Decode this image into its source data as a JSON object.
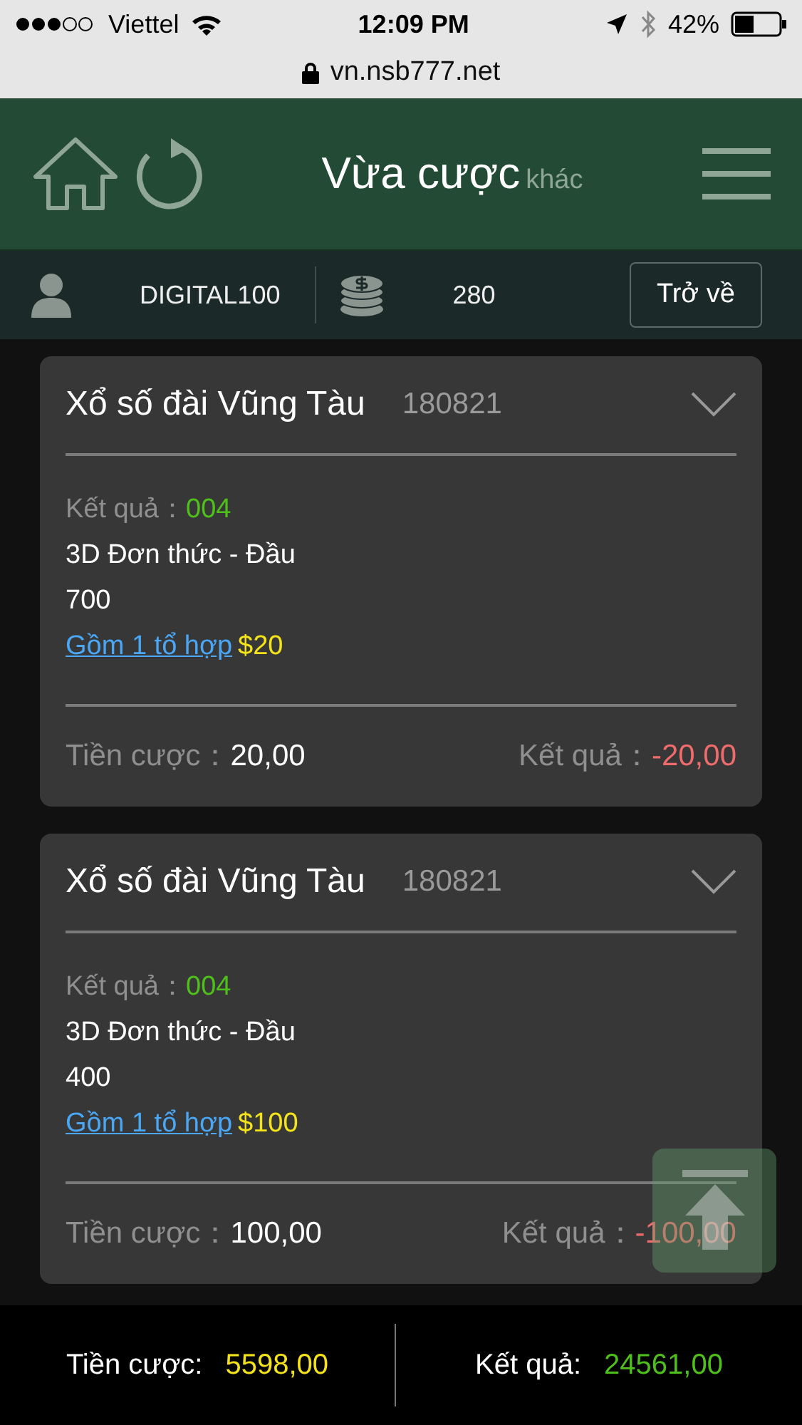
{
  "status_bar": {
    "carrier": "Viettel",
    "time": "12:09 PM",
    "battery": "42%"
  },
  "url_bar": {
    "url": "vn.nsb777.net"
  },
  "header": {
    "title": "Vừa cược",
    "subtitle": "khác"
  },
  "account": {
    "username": "DIGITAL100",
    "balance": "280",
    "back_button": "Trở về"
  },
  "bets": [
    {
      "title": "Xổ số đài Vũng Tàu",
      "draw": "180821",
      "result_label": "Kết quả：",
      "result": "004",
      "bet_type": "3D Đơn thức - Đầu",
      "number": "700",
      "combo_link": "Gồm 1 tổ hợp",
      "combo_amount": "$20",
      "stake_label": "Tiền cược：",
      "stake": "20,00",
      "win_label": "Kết quả：",
      "win": "-20,00"
    },
    {
      "title": "Xổ số đài Vũng Tàu",
      "draw": "180821",
      "result_label": "Kết quả：",
      "result": "004",
      "bet_type": "3D Đơn thức - Đầu",
      "number": "400",
      "combo_link": "Gồm 1 tổ hợp",
      "combo_amount": "$100",
      "stake_label": "Tiền cược：",
      "stake": "100,00",
      "win_label": "Kết quả：",
      "win": "-100,00"
    }
  ],
  "totals": {
    "stake_label": "Tiền cược:",
    "stake": "5598,00",
    "result_label": "Kết quả:",
    "result": "24561,00"
  }
}
